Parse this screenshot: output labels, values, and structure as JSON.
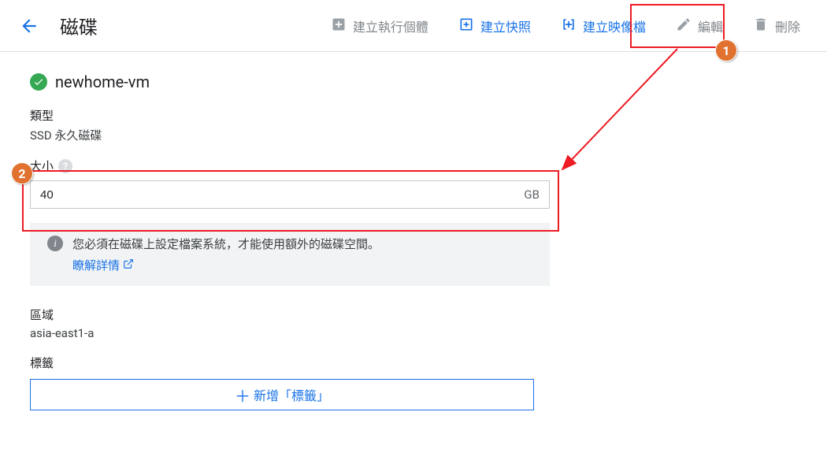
{
  "header": {
    "title": "磁碟",
    "actions": {
      "create_instance": "建立執行個體",
      "create_snapshot": "建立快照",
      "create_image": "建立映像檔",
      "edit": "編輯",
      "delete": "刪除"
    }
  },
  "disk": {
    "name": "newhome-vm",
    "type_label": "類型",
    "type_value": "SSD 永久磁碟",
    "size_label": "大小",
    "size_value": "40",
    "size_unit": "GB",
    "info_text": "您必須在磁碟上設定檔案系統，才能使用額外的磁碟空間。",
    "learn_more": "瞭解詳情",
    "zone_label": "區域",
    "zone_value": "asia-east1-a",
    "labels_label": "標籤",
    "add_label_button": "新增「標籤」"
  },
  "annotations": {
    "badge1": "1",
    "badge2": "2"
  }
}
